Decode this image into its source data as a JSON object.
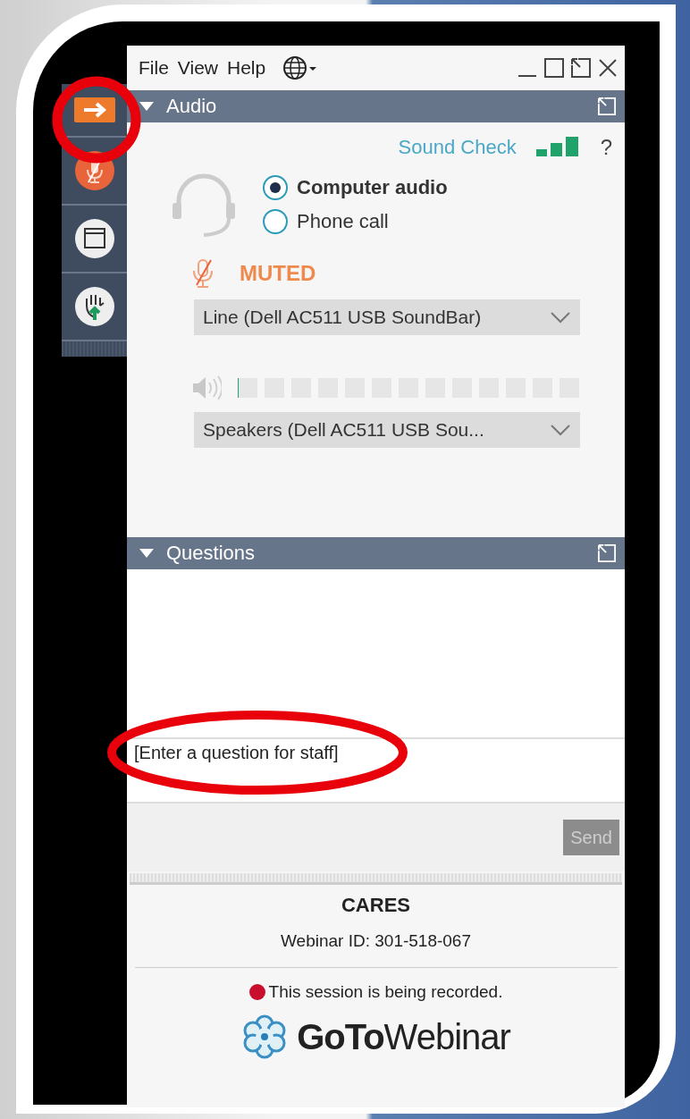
{
  "menu": [
    "File",
    "View",
    "Help"
  ],
  "toolbar": [
    {
      "kind": "arrow"
    },
    {
      "kind": "mic"
    },
    {
      "kind": "window"
    },
    {
      "kind": "hand"
    }
  ],
  "audio": {
    "title": "Audio",
    "expanded": true,
    "sound_check": "Sound Check",
    "help": "?",
    "modes": [
      {
        "label": "Computer audio",
        "selected": true
      },
      {
        "label": "Phone call",
        "selected": false
      }
    ],
    "muted": true,
    "mic_status": "MUTED",
    "microphone": "Line (Dell AC511 USB SoundBar)",
    "level": 0,
    "speaker": "Speakers (Dell AC511 USB Sou..."
  },
  "questions": {
    "title": "Questions",
    "expanded": true,
    "placeholder": "[Enter a question for staff]",
    "send": "Send",
    "send_disabled": true
  },
  "footer": {
    "organizer": "CARES",
    "webinar_id": "Webinar ID: 301-518-067",
    "recording_on": true,
    "recording": "This session is being recorded.",
    "brand": "**GoTo**Webinar"
  }
}
